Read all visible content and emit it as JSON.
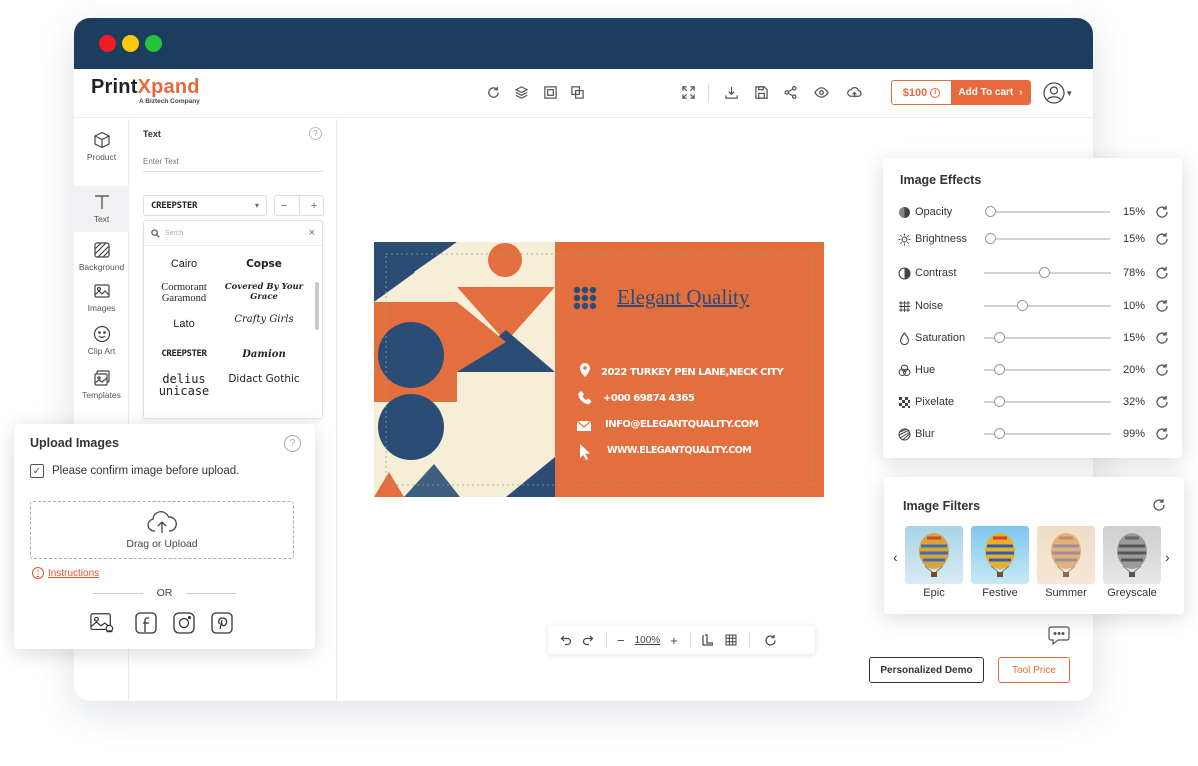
{
  "logo": {
    "main_a": "Print",
    "main_b": "Xpand",
    "subtitle": "A Biztech Company"
  },
  "toolbar": {
    "price": "$100",
    "cart_label": "Add To cart",
    "icons": [
      "refresh-icon",
      "layers-icon",
      "image-swap-icon",
      "duplicate-icon",
      "fullscreen-icon",
      "download-icon",
      "save-icon",
      "share-icon",
      "preview-icon",
      "cloud-icon"
    ]
  },
  "leftbar": {
    "items": [
      {
        "label": "Product",
        "icon": "box-icon"
      },
      {
        "label": "Text",
        "icon": "text-icon"
      },
      {
        "label": "Background",
        "icon": "background-icon"
      },
      {
        "label": "Images",
        "icon": "image-icon"
      },
      {
        "label": "Clip Art",
        "icon": "smiley-icon"
      },
      {
        "label": "Templates",
        "icon": "templates-icon"
      }
    ]
  },
  "text_panel": {
    "label": "Text",
    "input_placeholder": "Enter Text",
    "font_selected": "CREEPSTER",
    "stepper_minus": "−",
    "stepper_plus": "+",
    "search_placeholder": "Serch",
    "fonts": [
      "Cairo",
      "Copse",
      "Cormorant Garamond",
      "Covered By Your Grace",
      "Lato",
      "Crafty Girls",
      "CREEPSTER",
      "Damion",
      "Delius Unicase",
      "Didact Gothic"
    ]
  },
  "card": {
    "title": "Elegant Quality",
    "address": "2022 TURKEY PEN LANE,NECK CITY",
    "phone": "+000 69874 4365",
    "email": "INFO@ELEGANTQUALITY.COM",
    "web": "WWW.ELEGANTQUALITY.COM",
    "colors": {
      "orange": "#e36f3f",
      "navy": "#2b4d75",
      "cream": "#f6eed6"
    }
  },
  "bottom_tools": {
    "zoom": "100%"
  },
  "buttons": {
    "demo": "Personalized Demo",
    "tool_price": "Tool Price"
  },
  "effects": {
    "title": "Image Effects",
    "rows": [
      {
        "label": "Opacity",
        "value": "15%",
        "level": 0.0
      },
      {
        "label": "Brightness",
        "value": "15%",
        "level": 0.0
      },
      {
        "label": "Contrast",
        "value": "78%",
        "level": 0.43
      },
      {
        "label": "Noise",
        "value": "10%",
        "level": 0.26
      },
      {
        "label": "Saturation",
        "value": "15%",
        "level": 0.08
      },
      {
        "label": "Hue",
        "value": "20%",
        "level": 0.08
      },
      {
        "label": "Pixelate",
        "value": "32%",
        "level": 0.08
      },
      {
        "label": "Blur",
        "value": "99%",
        "level": 0.08
      }
    ]
  },
  "filters": {
    "title": "Image Filters",
    "items": [
      {
        "label": "Epic"
      },
      {
        "label": "Festive"
      },
      {
        "label": "Summer"
      },
      {
        "label": "Greyscale"
      }
    ]
  },
  "upload": {
    "title": "Upload Images",
    "confirm": "Please confirm image before upload.",
    "drop_label": "Drag or Upload",
    "instructions": "Instructions",
    "or": "OR",
    "sources": [
      "gallery-icon",
      "facebook-icon",
      "instagram-icon",
      "pinterest-icon"
    ]
  }
}
